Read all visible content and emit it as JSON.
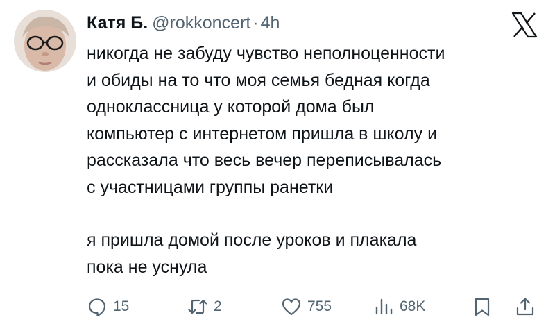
{
  "author": {
    "name": "Катя Б.",
    "handle": "@rokkoncert",
    "separator": "·",
    "time": "4h"
  },
  "tweet": {
    "lines_p1": [
      "никогда не забуду чувство неполноценности",
      "и обиды на то что моя семья бедная когда",
      "одноклассница у которой дома был",
      "компьютер с интернетом пришла в школу и",
      "рассказала что весь вечер переписывалась",
      "с участницами группы ранетки"
    ],
    "lines_p2": [
      "я пришла домой после уроков и плакала",
      "пока не уснула"
    ]
  },
  "actions": {
    "replies": "15",
    "retweets": "2",
    "likes": "755",
    "views": "68K"
  },
  "icons": {
    "logo": "x-logo-icon",
    "reply": "reply-icon",
    "retweet": "retweet-icon",
    "like": "heart-icon",
    "views": "views-icon",
    "bookmark": "bookmark-icon",
    "share": "share-icon"
  },
  "colors": {
    "text": "#0f1419",
    "secondary": "#536471"
  }
}
